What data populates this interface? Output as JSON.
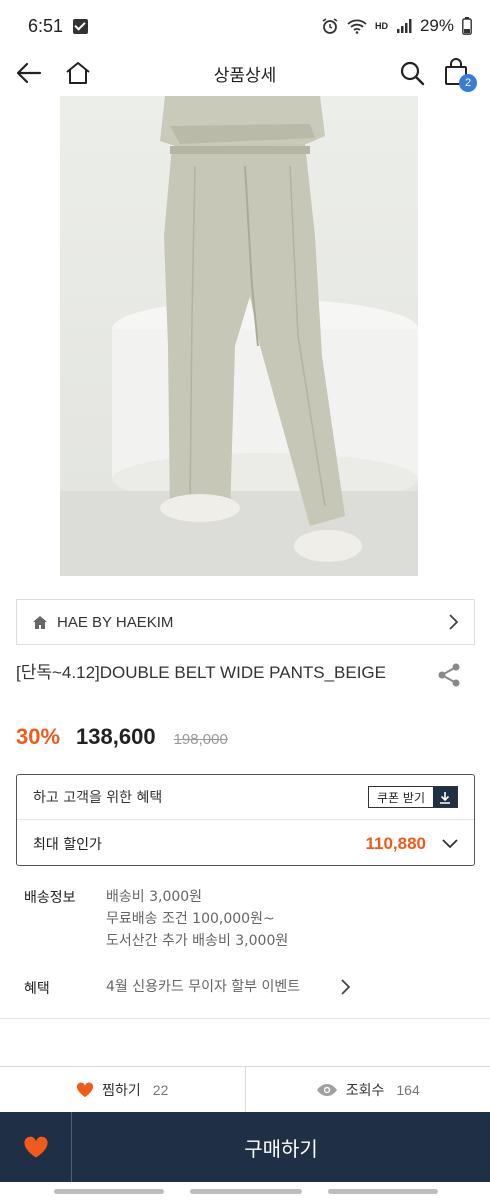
{
  "status_bar": {
    "time": "6:51",
    "battery": "29%",
    "network_label": "HD"
  },
  "header": {
    "title": "상품상세",
    "cart_count": "2"
  },
  "brand": {
    "name": "HAE BY HAEKIM"
  },
  "product": {
    "name": "[단독~4.12]DOUBLE BELT WIDE PANTS_BEIGE",
    "discount": "30%",
    "price": "138,600",
    "original_price": "198,000"
  },
  "coupon": {
    "benefit_text": "하고 고객을 위한 혜택",
    "button_label": "쿠폰 받기",
    "max_label": "최대 할인가",
    "max_price": "110,880"
  },
  "shipping": {
    "label": "배송정보",
    "lines": [
      "배송비 3,000원",
      "무료배송 조건 100,000원~",
      "도서산간 추가 배송비 3,000원"
    ]
  },
  "benefit": {
    "label": "혜택",
    "value": "4월 신용카드 무이자 할부 이벤트"
  },
  "stats": {
    "like_label": "찜하기",
    "like_count": "22",
    "view_label": "조회수",
    "view_count": "164"
  },
  "bottom": {
    "buy_label": "구매하기"
  },
  "colors": {
    "accent": "#f05a1a",
    "navy": "#1f2f46",
    "badge_blue": "#3a7bd5"
  }
}
